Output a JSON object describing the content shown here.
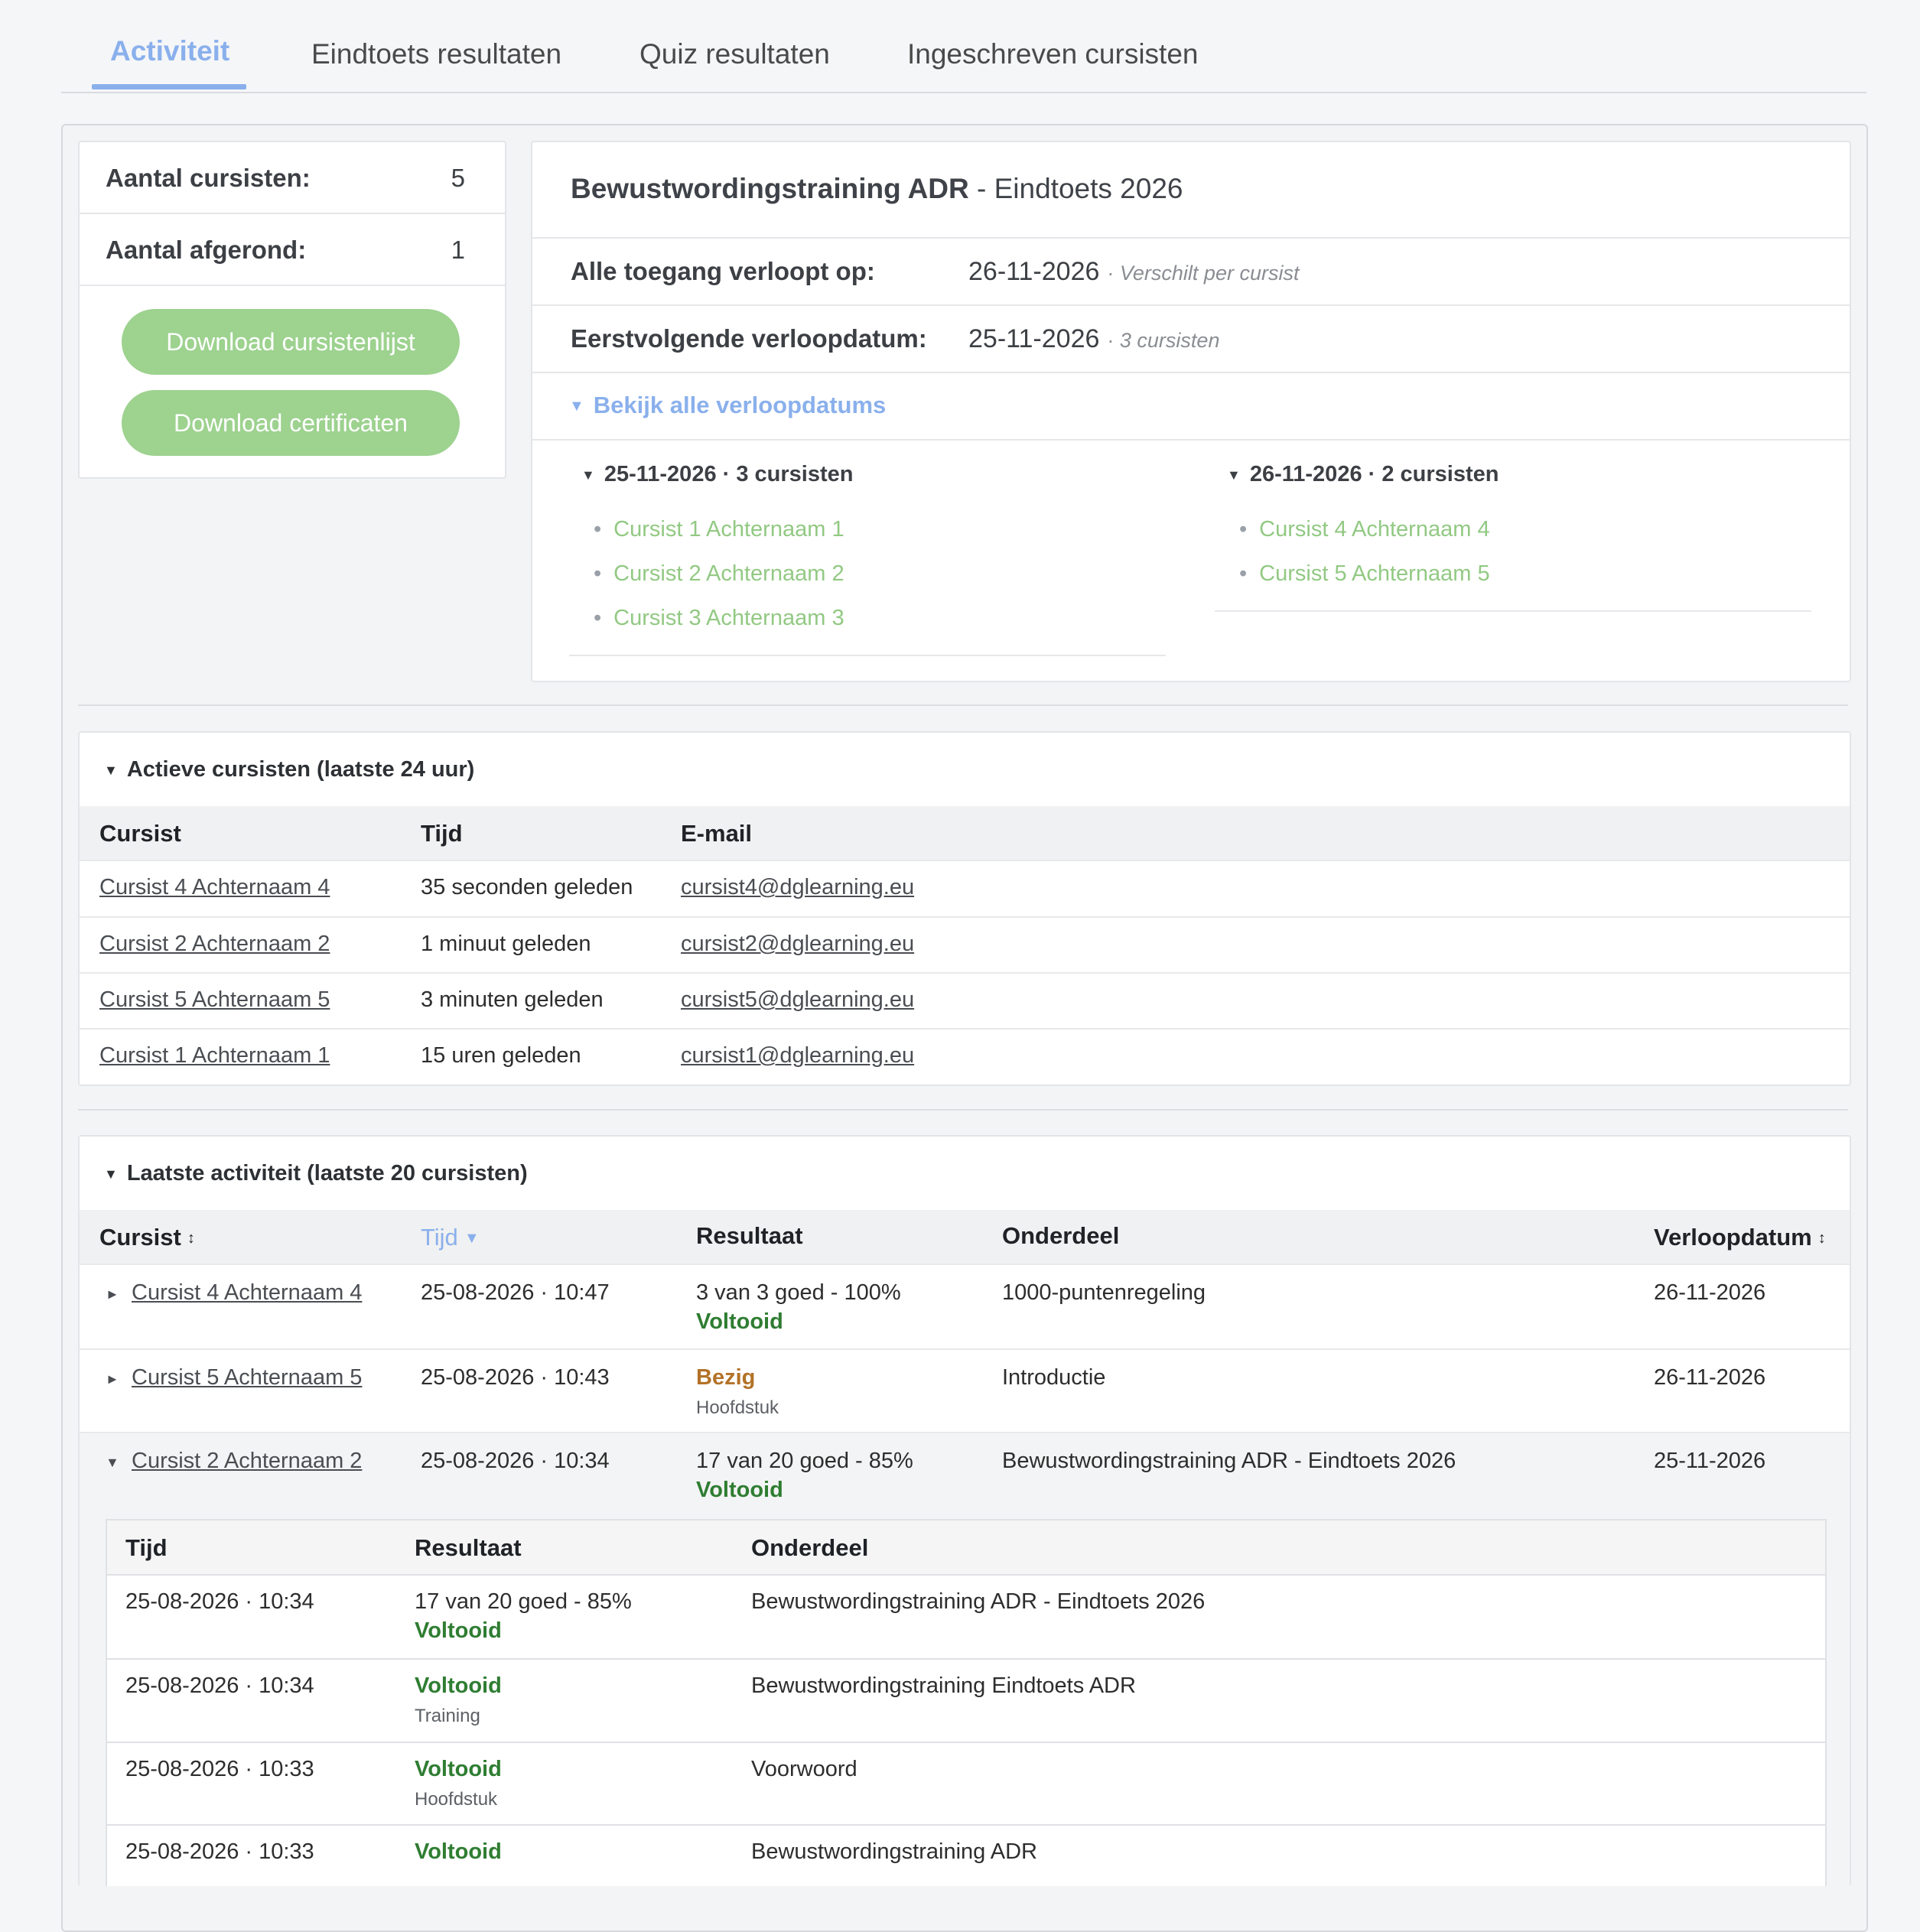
{
  "tabs": [
    "Activiteit",
    "Eindtoets resultaten",
    "Quiz resultaten",
    "Ingeschreven cursisten"
  ],
  "stats": {
    "students_label": "Aantal cursisten:",
    "students_value": "5",
    "completed_label": "Aantal afgerond:",
    "completed_value": "1",
    "download_list": "Download cursistenlijst",
    "download_certs": "Download certificaten"
  },
  "course": {
    "title_bold": "Bewustwordingstraining ADR",
    "title_rest": " - Eindtoets 2026",
    "access_label": "Alle toegang verloopt op:",
    "access_value": "26-11-2026",
    "access_note": "· Verschilt per cursist",
    "next_label": "Eerstvolgende verloopdatum:",
    "next_value": "25-11-2026",
    "next_note": "· 3 cursisten",
    "toggle_all": "Bekijk alle verloopdatums",
    "groups": [
      {
        "title": "25-11-2026 · 3 cursisten",
        "students": [
          "Cursist 1 Achternaam 1",
          "Cursist 2 Achternaam 2",
          "Cursist 3 Achternaam 3"
        ]
      },
      {
        "title": "26-11-2026 · 2 cursisten",
        "students": [
          "Cursist 4 Achternaam 4",
          "Cursist 5 Achternaam 5"
        ]
      }
    ]
  },
  "active": {
    "title": "Actieve cursisten (laatste 24 uur)",
    "headers": [
      "Cursist",
      "Tijd",
      "E-mail"
    ],
    "rows": [
      {
        "name": "Cursist 4 Achternaam 4",
        "time": "35 seconden geleden",
        "email": "cursist4@dglearning.eu"
      },
      {
        "name": "Cursist 2 Achternaam 2",
        "time": "1 minuut geleden",
        "email": "cursist2@dglearning.eu"
      },
      {
        "name": "Cursist 5 Achternaam 5",
        "time": "3 minuten geleden",
        "email": "cursist5@dglearning.eu"
      },
      {
        "name": "Cursist 1 Achternaam 1",
        "time": "15 uren geleden",
        "email": "cursist1@dglearning.eu"
      }
    ]
  },
  "activity": {
    "title": "Laatste activiteit (laatste 20 cursisten)",
    "headers": [
      "Cursist",
      "Tijd",
      "Resultaat",
      "Onderdeel",
      "Verloopdatum"
    ],
    "rows": [
      {
        "name": "Cursist 4 Achternaam 4",
        "time": "25-08-2026 · 10:47",
        "result": "3 van 3 goed - 100%",
        "status": "Voltooid",
        "part": "1000-puntenregeling",
        "expiry": "26-11-2026"
      },
      {
        "name": "Cursist 5 Achternaam 5",
        "time": "25-08-2026 · 10:43",
        "status": "Bezig",
        "sub": "Hoofdstuk",
        "part": "Introductie",
        "expiry": "26-11-2026"
      },
      {
        "name": "Cursist 2 Achternaam 2",
        "time": "25-08-2026 · 10:34",
        "result": "17 van 20 goed - 85%",
        "status": "Voltooid",
        "part": "Bewustwordingstraining ADR - Eindtoets 2026",
        "expiry": "25-11-2026"
      }
    ],
    "nested": {
      "headers": [
        "Tijd",
        "Resultaat",
        "Onderdeel"
      ],
      "rows": [
        {
          "time": "25-08-2026 · 10:34",
          "result": "17 van 20 goed - 85%",
          "status": "Voltooid",
          "part": "Bewustwordingstraining ADR - Eindtoets 2026"
        },
        {
          "time": "25-08-2026 · 10:34",
          "status": "Voltooid",
          "sub": "Training",
          "part": "Bewustwordingstraining Eindtoets ADR"
        },
        {
          "time": "25-08-2026 · 10:33",
          "status": "Voltooid",
          "sub": "Hoofdstuk",
          "part": "Voorwoord"
        },
        {
          "time": "25-08-2026 · 10:33",
          "status": "Voltooid",
          "part": "Bewustwordingstraining ADR"
        }
      ]
    }
  },
  "colors": {
    "accent": "#8ab0ec",
    "button": "#9dd28f",
    "success": "#2f7d32",
    "busy": "#b37227",
    "link_green": "#92c983"
  }
}
